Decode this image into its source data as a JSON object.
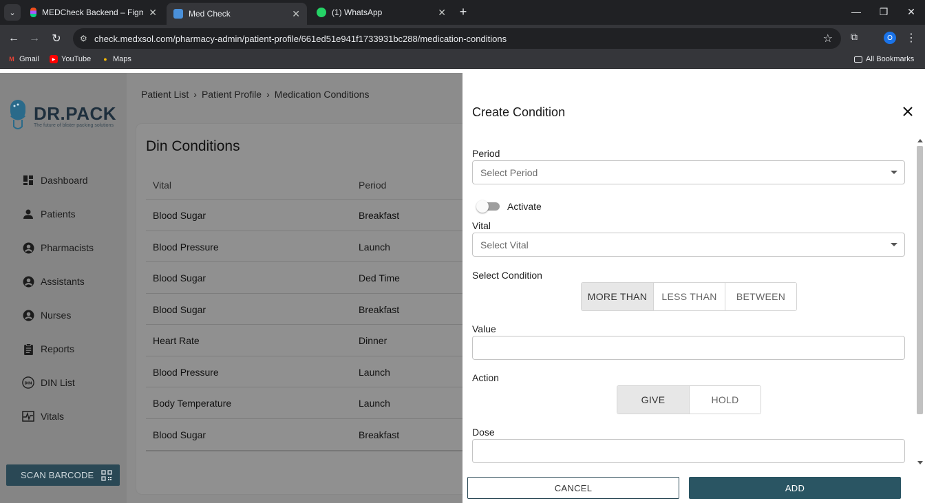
{
  "browser": {
    "tabs": [
      {
        "title": "MEDCheck Backend – Figma",
        "icon": "figma-icon",
        "active": false
      },
      {
        "title": "Med Check",
        "icon": "medcheck-icon",
        "active": true
      },
      {
        "title": "(1) WhatsApp",
        "icon": "whatsapp-icon",
        "active": false
      }
    ],
    "url": "check.medxsol.com/pharmacy-admin/patient-profile/661ed51e941f1733931bc288/medication-conditions",
    "profile_initial": "O",
    "bookmarks": [
      {
        "label": "Gmail",
        "icon": "gmail-icon"
      },
      {
        "label": "YouTube",
        "icon": "youtube-icon"
      },
      {
        "label": "Maps",
        "icon": "maps-icon"
      }
    ],
    "all_bookmarks": "All Bookmarks"
  },
  "brand": {
    "name": "DR.PACK",
    "tagline": "The future of blister packing solutions"
  },
  "sidebar": {
    "items": [
      {
        "label": "Dashboard",
        "icon": "dashboard-icon"
      },
      {
        "label": "Patients",
        "icon": "person-icon"
      },
      {
        "label": "Pharmacists",
        "icon": "account-circle-icon"
      },
      {
        "label": "Assistants",
        "icon": "account-circle-icon"
      },
      {
        "label": "Nurses",
        "icon": "account-circle-icon"
      },
      {
        "label": "Reports",
        "icon": "clipboard-icon"
      },
      {
        "label": "DIN List",
        "icon": "din-icon"
      },
      {
        "label": "Vitals",
        "icon": "vitals-icon"
      }
    ],
    "scan_label": "SCAN BARCODE"
  },
  "breadcrumb": [
    "Patient List",
    "Patient Profile",
    "Medication Conditions"
  ],
  "breadcrumb_sep": "›",
  "conditions": {
    "title": "Din Conditions",
    "columns": [
      "Vital",
      "Period"
    ],
    "rows": [
      {
        "vital": "Blood Sugar",
        "period": "Breakfast"
      },
      {
        "vital": "Blood Pressure",
        "period": "Launch"
      },
      {
        "vital": "Blood Sugar",
        "period": "Ded Time"
      },
      {
        "vital": "Blood Sugar",
        "period": "Breakfast"
      },
      {
        "vital": "Heart Rate",
        "period": "Dinner"
      },
      {
        "vital": "Blood Pressure",
        "period": "Launch"
      },
      {
        "vital": "Body Temperature",
        "period": "Launch"
      },
      {
        "vital": "Blood Sugar",
        "period": "Breakfast"
      }
    ]
  },
  "drawer": {
    "title": "Create Condition",
    "period_label": "Period",
    "period_placeholder": "Select Period",
    "activate_label": "Activate",
    "activate_on": false,
    "vital_label": "Vital",
    "vital_placeholder": "Select Vital",
    "condition_label": "Select Condition",
    "conditions": [
      "MORE THAN",
      "LESS THAN",
      "BETWEEN"
    ],
    "condition_selected": "MORE THAN",
    "value_label": "Value",
    "value": "",
    "action_label": "Action",
    "actions": [
      "GIVE",
      "HOLD"
    ],
    "action_selected": "GIVE",
    "dose_label": "Dose",
    "dose": "",
    "cancel_label": "CANCEL",
    "add_label": "ADD"
  },
  "colors": {
    "primary": "#2a5563",
    "overlay": "#8c8c8c",
    "chrome_dark": "#202124"
  }
}
